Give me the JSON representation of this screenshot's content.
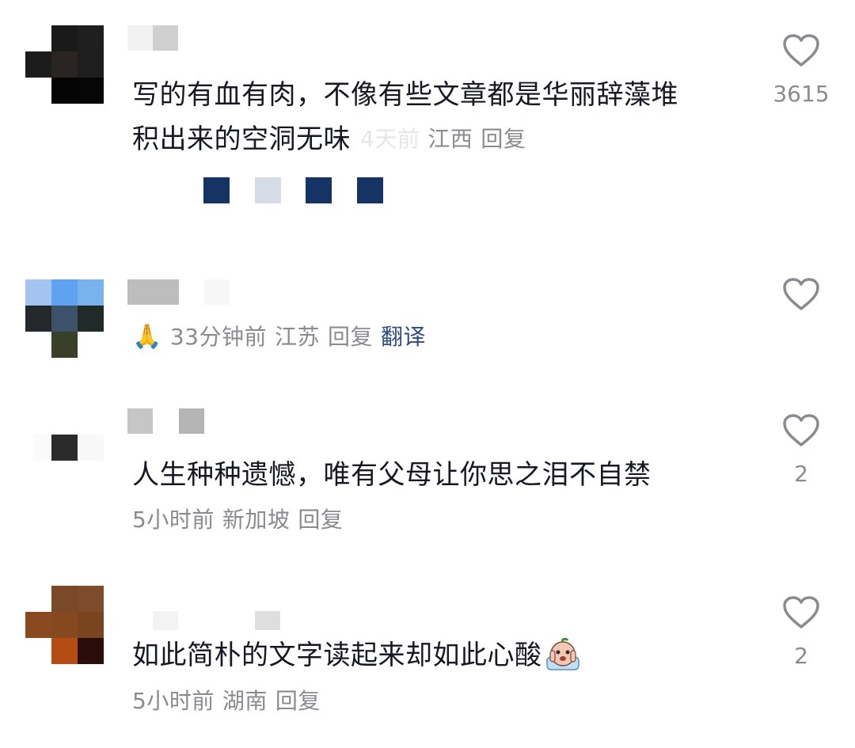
{
  "comments": [
    {
      "text_line1": "写的有血有肉，不像有些文章都是华丽辞藻堆",
      "text_line2": "积出来的空洞无味",
      "time": "4天前",
      "location": "江西",
      "reply": "回复",
      "likes": "3615"
    },
    {
      "prefix_emoji": "🙏",
      "time": "33分钟前",
      "location": "江苏",
      "reply": "回复",
      "translate": "翻译",
      "likes": ""
    },
    {
      "text": "人生种种遗憾，唯有父母让你思之泪不自禁",
      "time": "5小时前",
      "location": "新加坡",
      "reply": "回复",
      "likes": "2"
    },
    {
      "text": "如此简朴的文字读起来却如此心酸",
      "time": "5小时前",
      "location": "湖南",
      "reply": "回复",
      "likes": "2"
    }
  ],
  "icons": {
    "like": "heart-outline-icon",
    "pray": "folded-hands-emoji",
    "cry": "crying-face-sticker"
  },
  "colors": {
    "text": "#161823",
    "meta": "#8a8b91",
    "link": "#2b4a86",
    "heart": "#8a8b91"
  }
}
